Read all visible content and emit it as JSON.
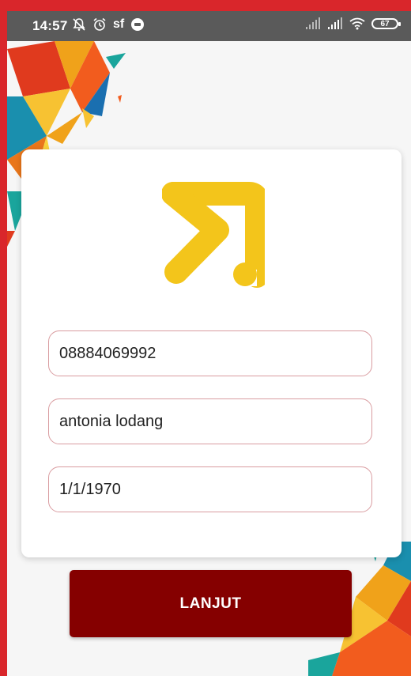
{
  "status_bar": {
    "time": "14:57",
    "carrier_icon_text": "sf",
    "battery": "67",
    "icons": [
      "mute-icon",
      "alarm-icon",
      "sf-icon",
      "chat-icon",
      "signal-icon",
      "signal-icon",
      "wifi-icon",
      "battery-icon"
    ]
  },
  "form": {
    "phone_value": "08884069992",
    "name_value": "antonia lodang",
    "dob_value": "1/1/1970"
  },
  "actions": {
    "next_label": "LANJUT"
  },
  "colors": {
    "brand_yellow": "#f3c51b",
    "button_red": "#850000",
    "frame_red": "#d9262b",
    "field_border": "#d99ca0"
  }
}
